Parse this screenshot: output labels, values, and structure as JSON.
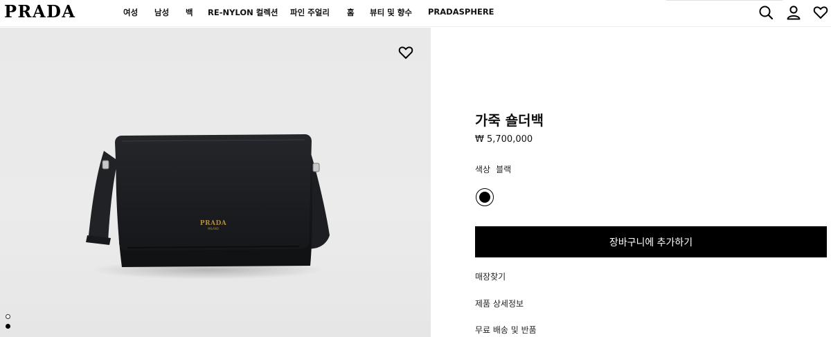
{
  "header": {
    "logo": "PRADA",
    "nav": [
      {
        "label": "여성"
      },
      {
        "label": "남성"
      },
      {
        "label": "백"
      },
      {
        "label": "RE-NYLON 컬렉션"
      },
      {
        "label": "파인 주얼리"
      },
      {
        "label": "홈"
      },
      {
        "label": "뷰티 및 향수"
      },
      {
        "label": "PRADASPHERE"
      }
    ],
    "icons": [
      "search-icon",
      "user-icon",
      "heart-icon"
    ]
  },
  "product": {
    "title": "가죽 숄더백",
    "price": "₩ 5,700,000",
    "color_label": "색상",
    "color_value": "블랙",
    "swatch_color": "#000000",
    "add_to_cart": "장바구니에 추가하기",
    "links": [
      "매장찾기",
      "제품 상세정보",
      "무료 배송 및 반품"
    ],
    "image": {
      "bag_logo": "PRADA",
      "bag_logo_sub": "MILANO",
      "bag_color": "#1c1d20",
      "background": "#e9e9e9"
    }
  },
  "carousel": {
    "slide_count": 2,
    "active_slide": 1
  },
  "colors": {
    "primary": "#000000",
    "button_text": "#ffffff",
    "logo_gold": "#b08a3e"
  }
}
